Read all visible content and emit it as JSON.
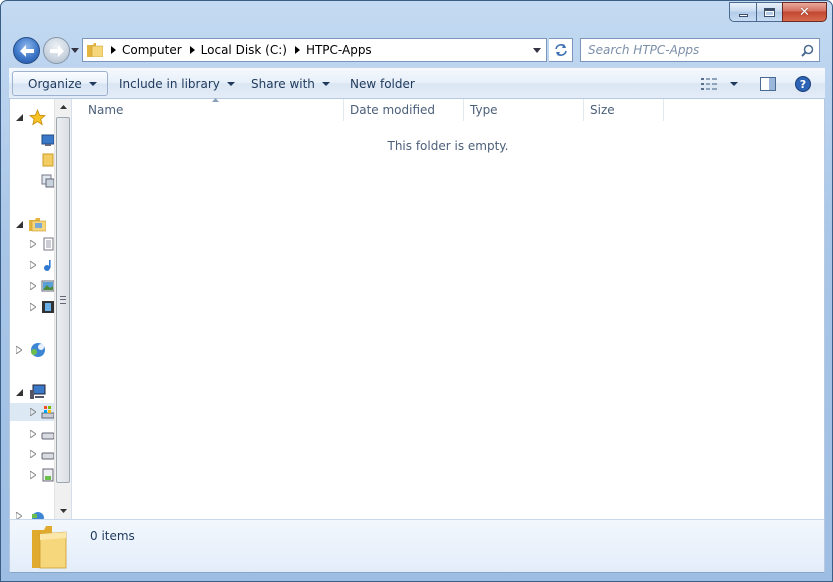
{
  "breadcrumb": [
    "Computer",
    "Local Disk (C:)",
    "HTPC-Apps"
  ],
  "search": {
    "placeholder": "Search HTPC-Apps"
  },
  "toolbar": {
    "organize": "Organize",
    "include_in_library": "Include in library",
    "share_with": "Share with",
    "new_folder": "New folder"
  },
  "columns": [
    "Name",
    "Date modified",
    "Type",
    "Size"
  ],
  "file_list": {
    "empty_message": "This folder is empty."
  },
  "details": {
    "item_count": "0 items"
  },
  "nav_tree_icons": [
    "favorites-star-icon",
    "desktop-icon",
    "downloads-icon",
    "recent-places-icon",
    "libraries-icon",
    "documents-icon",
    "music-icon",
    "pictures-icon",
    "videos-icon",
    "homegroup-icon",
    "computer-icon",
    "local-disk-icon",
    "drive-icon",
    "drive-icon",
    "drive-icon",
    "network-icon"
  ],
  "colors": {
    "frame": "#a9c6e8",
    "toolbar": "#e7eff9",
    "close_button": "#c24631",
    "text": "#1e395b"
  }
}
